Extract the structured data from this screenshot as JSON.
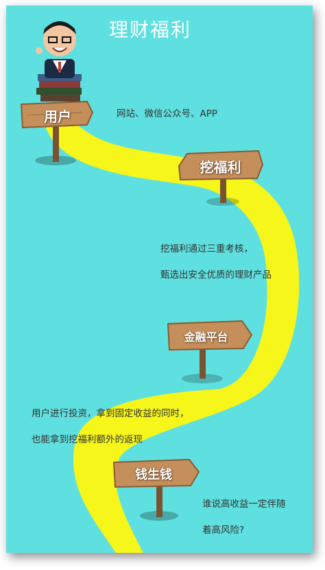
{
  "title": "理财福利",
  "steps": [
    {
      "sign": "用户",
      "lines": [
        "网站、微信公众号、APP"
      ]
    },
    {
      "sign": "挖福利",
      "lines": [
        "挖福利通过三重考核，",
        "甄选出安全优质的理财产品"
      ]
    },
    {
      "sign": "金融平台",
      "lines": [
        "用户进行投资，拿到固定收益的同时，",
        "也能拿到挖福利额外的返现"
      ]
    },
    {
      "sign": "钱生钱",
      "lines": [
        "谁说高收益一定伴随",
        "着高风险?"
      ]
    }
  ],
  "colors": {
    "background": "#5fe0e0",
    "path": "#f6f61a",
    "sign_wood": "#c58f5c",
    "text": "#333333"
  }
}
